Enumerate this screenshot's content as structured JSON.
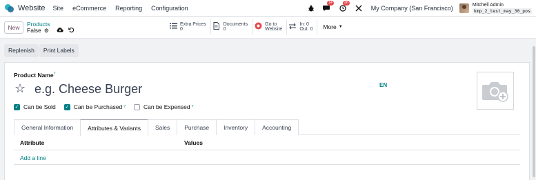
{
  "navbar": {
    "app_name": "Website",
    "menu": [
      "Site",
      "eCommerce",
      "Reporting",
      "Configuration"
    ],
    "messages_badge": "14",
    "activity_badge": "26",
    "company": "My Company (San Francisco)",
    "user_name": "Mitchell Admin",
    "database": "kmp_2_test_may_30_pos"
  },
  "control": {
    "new_label": "New",
    "breadcrumb_parent": "Products",
    "breadcrumb_current": "False",
    "stats": [
      {
        "icon": "list-icon",
        "line1": "Extra Prices",
        "line2": "0"
      },
      {
        "icon": "document-icon",
        "line1": "Documents",
        "line2": "0"
      },
      {
        "icon": "globe-icon",
        "line1": "Go to",
        "line2": "Website"
      },
      {
        "icon": "transfer-icon",
        "line1": "In: 0",
        "line2": "Out: 0"
      }
    ],
    "more_label": "More"
  },
  "actions": {
    "replenish": "Replenish",
    "print_labels": "Print Labels"
  },
  "form": {
    "product_name_label": "Product Name",
    "help_mark": "?",
    "name_placeholder": "e.g. Cheese Burger",
    "lang": "EN",
    "checkboxes": [
      {
        "label": "Can be Sold",
        "checked": true
      },
      {
        "label": "Can be Purchased",
        "checked": true
      },
      {
        "label": "Can be Expensed",
        "checked": false
      }
    ],
    "tabs": [
      "General Information",
      "Attributes & Variants",
      "Sales",
      "Purchase",
      "Inventory",
      "Accounting"
    ],
    "active_tab": "Attributes & Variants",
    "columns": [
      "Attribute",
      "Values"
    ],
    "add_line": "Add a line"
  },
  "colors": {
    "accent": "#017e84",
    "brand": "#714b67",
    "badge": "#e6474a"
  }
}
